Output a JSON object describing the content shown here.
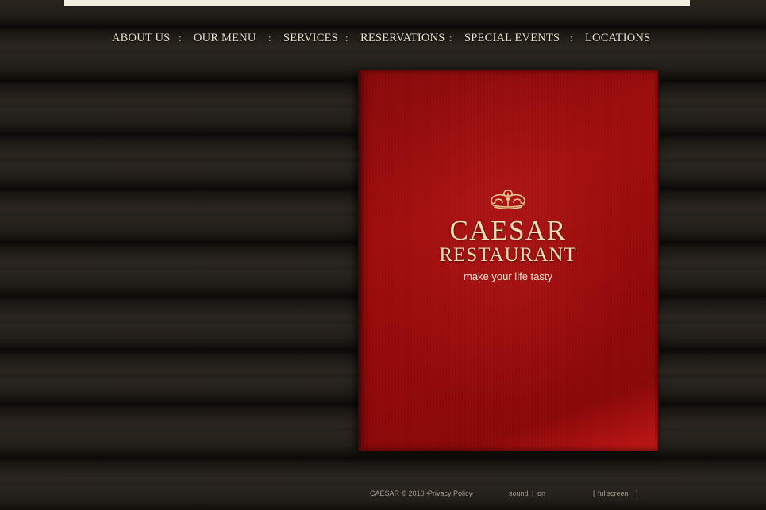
{
  "nav": {
    "items": [
      {
        "label": "ABOUT US"
      },
      {
        "label": "OUR MENU"
      },
      {
        "label": "SERVICES"
      },
      {
        "label": "RESERVATIONS"
      },
      {
        "label": "SPECIAL EVENTS"
      },
      {
        "label": "LOCATIONS"
      }
    ],
    "separator": ":"
  },
  "book": {
    "title": "CAESAR",
    "subtitle": "RESTAURANT",
    "tagline": "make your life tasty",
    "emblem_icon": "ornament-crest-icon",
    "cover_color": "#9a0b0b",
    "text_color": "#f1dfb7"
  },
  "footer": {
    "copyright": "CAESAR © 2010 •",
    "privacy_label": "Privacy Policy",
    "bullet": "•",
    "sound_label": "sound",
    "sound_divider": "|",
    "sound_state": "on",
    "bracket_open": "[",
    "fullscreen_label": "fullscreen",
    "bracket_close": "]"
  }
}
